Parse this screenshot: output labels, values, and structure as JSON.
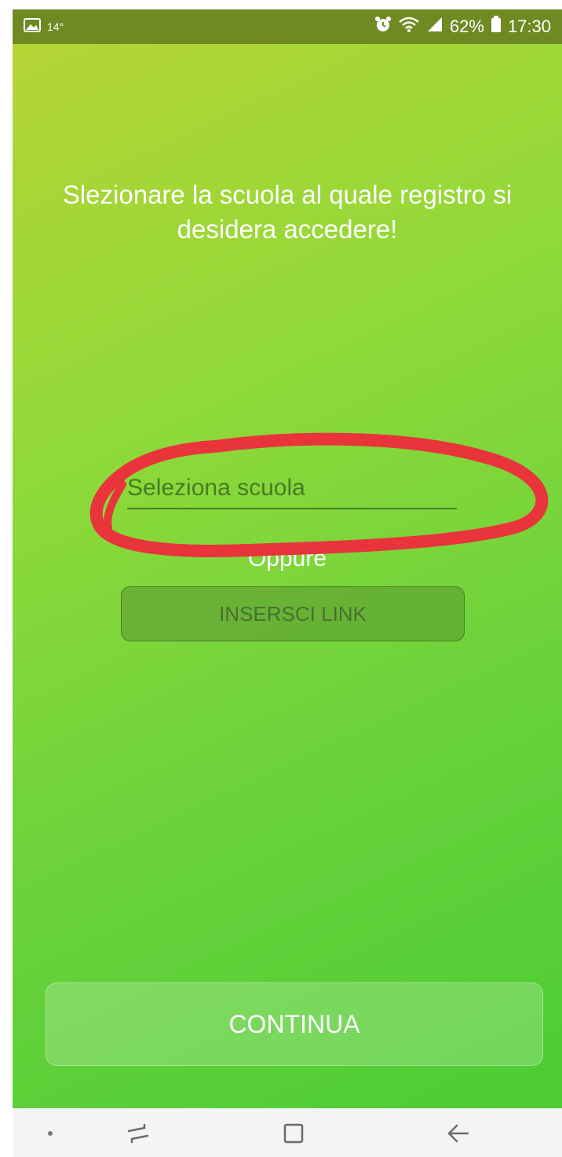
{
  "status_bar": {
    "temperature": "14°",
    "battery_percent": "62%",
    "time": "17:30",
    "icons": [
      "image-icon",
      "alarm-icon",
      "wifi-icon",
      "signal-icon",
      "battery-icon"
    ]
  },
  "main": {
    "prompt": "Slezionare la scuola al quale registro si desidera accedere!",
    "school_select": {
      "placeholder": "Seleziona scuola",
      "value": ""
    },
    "oppure": "Oppure",
    "insert_link_label": "INSERSCI LINK",
    "continue_label": "CONTINUA"
  },
  "colors": {
    "status_bar": "#6f8a22",
    "gradient_start": "#b5d433",
    "gradient_end": "#4ccc33",
    "annotation": "#e8343a"
  },
  "nav_bar": {
    "items": [
      "dot-icon",
      "recent-apps-icon",
      "home-icon",
      "back-icon"
    ]
  }
}
